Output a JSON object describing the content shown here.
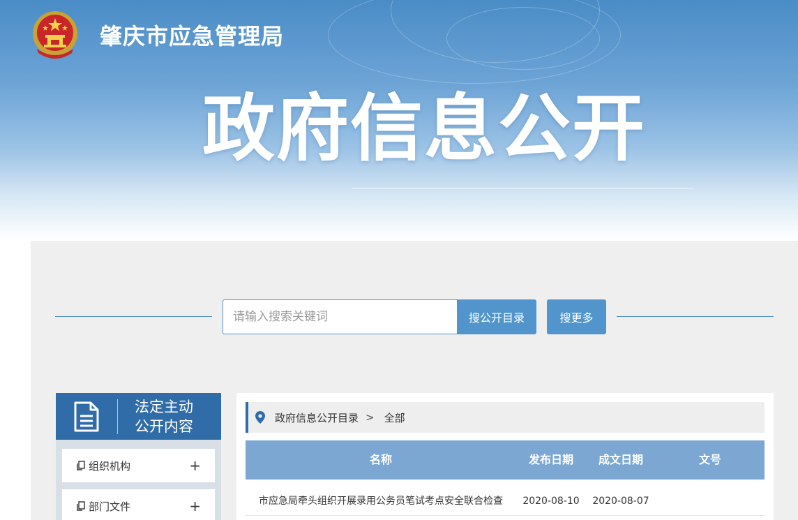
{
  "header": {
    "site_title": "肇庆市应急管理局",
    "hero_title": "政府信息公开"
  },
  "search": {
    "placeholder": "请输入搜索关键词",
    "catalog_button": "搜公开目录",
    "more_button": "搜更多"
  },
  "sidebar": {
    "header_line1": "法定主动",
    "header_line2": "公开内容",
    "items": [
      {
        "label": "组织机构",
        "toggle": "+"
      },
      {
        "label": "部门文件",
        "toggle": "+"
      }
    ]
  },
  "breadcrumb": {
    "root": "政府信息公开目录",
    "separator": ">",
    "current": "全部"
  },
  "table": {
    "headers": [
      "名称",
      "发布日期",
      "成文日期",
      "文号"
    ],
    "rows": [
      {
        "name": "市应急局牵头组织开展录用公务员笔试考点安全联合检查",
        "published": "2020-08-10",
        "written": "2020-08-07",
        "doc_no": ""
      }
    ]
  },
  "colors": {
    "primary": "#2f6ca8",
    "button": "#5195cc",
    "table_header": "#7ca7d2",
    "background": "#efefef"
  }
}
